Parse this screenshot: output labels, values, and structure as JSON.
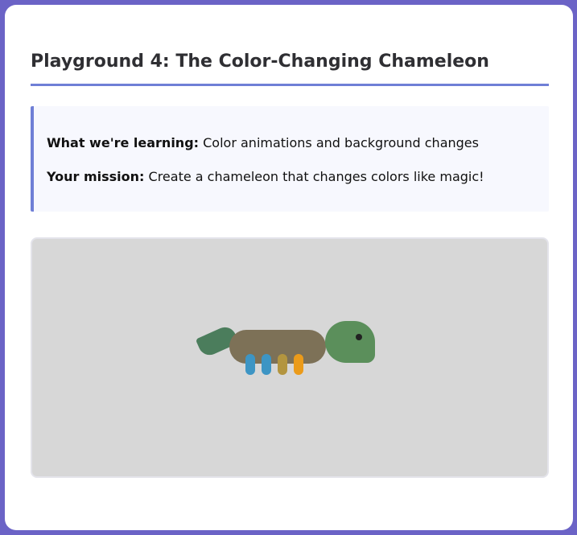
{
  "header": {
    "title": "Playground 4: The Color-Changing Chameleon"
  },
  "info": {
    "learning_label": "What we're learning:",
    "learning_text": " Color animations and background changes",
    "mission_label": "Your mission:",
    "mission_text": " Create a chameleon that changes colors like magic!"
  },
  "stage": {
    "background_color": "#d7d7d7",
    "chameleon": {
      "tail_color": "#4b7d5c",
      "body_color": "#7d7157",
      "head_color": "#5b8f5b",
      "eye_color": "#222222",
      "leg_colors": [
        "#3d95c4",
        "#3d95c4",
        "#b3953f",
        "#eb9b1a"
      ]
    }
  },
  "colors": {
    "page_background": "#6b63c6",
    "accent": "#6f7fd6",
    "info_background": "#f7f8fe"
  }
}
